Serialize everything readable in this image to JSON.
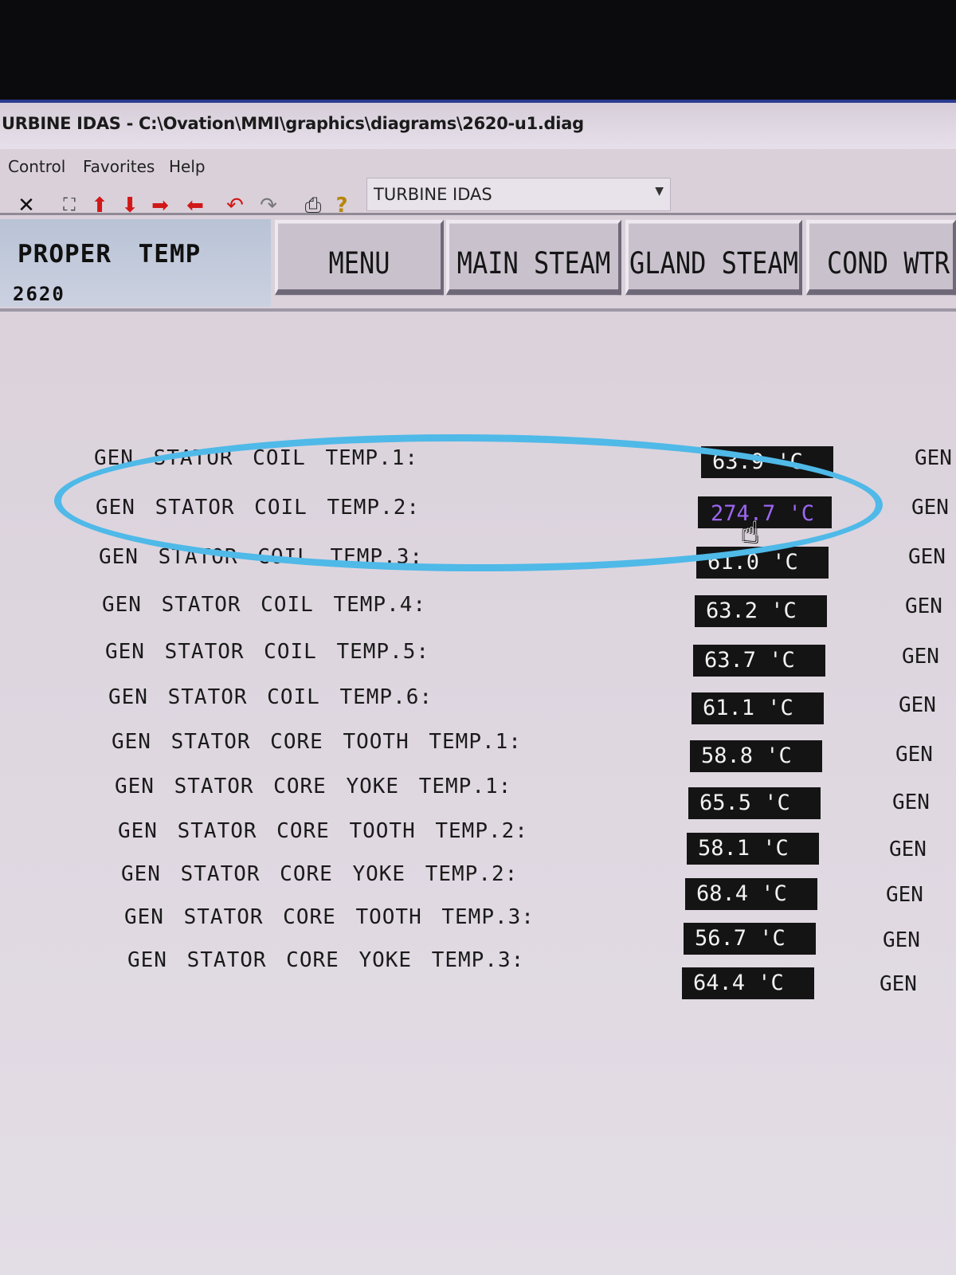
{
  "window": {
    "title": "URBINE IDAS - C:\\Ovation\\MMI\\graphics\\diagrams\\2620-u1.diag"
  },
  "menubar": {
    "items": [
      "Control",
      "Favorites",
      "Help"
    ]
  },
  "toolbar": {
    "icons": [
      "close-icon",
      "fit-window-icon",
      "arrow-up-icon",
      "arrow-down-icon",
      "arrow-right-icon",
      "arrow-left-icon",
      "back-icon",
      "forward-icon",
      "print-icon",
      "help-icon"
    ],
    "combo_value": "TURBINE IDAS"
  },
  "panel": {
    "title": "PROPER TEMP",
    "number": "2620"
  },
  "nav_buttons": [
    "MENU",
    "MAIN STEAM",
    "GLAND STEAM",
    "COND WTR"
  ],
  "rows": [
    {
      "label": "GEN STATOR COIL TEMP.1:",
      "value": "63.9 'C",
      "right": "GEN"
    },
    {
      "label": "GEN STATOR COIL TEMP.2:",
      "value": "274.7 'C",
      "right": "GEN",
      "alarm": true
    },
    {
      "label": "GEN STATOR COIL TEMP.3:",
      "value": "61.0 'C",
      "right": "GEN"
    },
    {
      "label": "GEN STATOR COIL TEMP.4:",
      "value": "63.2 'C",
      "right": "GEN"
    },
    {
      "label": "GEN STATOR COIL TEMP.5:",
      "value": "63.7 'C",
      "right": "GEN"
    },
    {
      "label": "GEN STATOR COIL TEMP.6:",
      "value": "61.1 'C",
      "right": "GEN"
    },
    {
      "label": "GEN STATOR CORE TOOTH TEMP.1:",
      "value": "58.8 'C",
      "right": "GEN"
    },
    {
      "label": "GEN STATOR CORE YOKE TEMP.1:",
      "value": "65.5 'C",
      "right": "GEN"
    },
    {
      "label": "GEN STATOR CORE TOOTH TEMP.2:",
      "value": "58.1 'C",
      "right": "GEN"
    },
    {
      "label": "GEN STATOR CORE YOKE TEMP.2:",
      "value": "68.4 'C",
      "right": "GEN"
    },
    {
      "label": "GEN STATOR CORE TOOTH TEMP.3:",
      "value": "56.7 'C",
      "right": "GEN"
    },
    {
      "label": "GEN STATOR CORE YOKE TEMP.3:",
      "value": "64.4 'C",
      "right": "GEN"
    }
  ]
}
